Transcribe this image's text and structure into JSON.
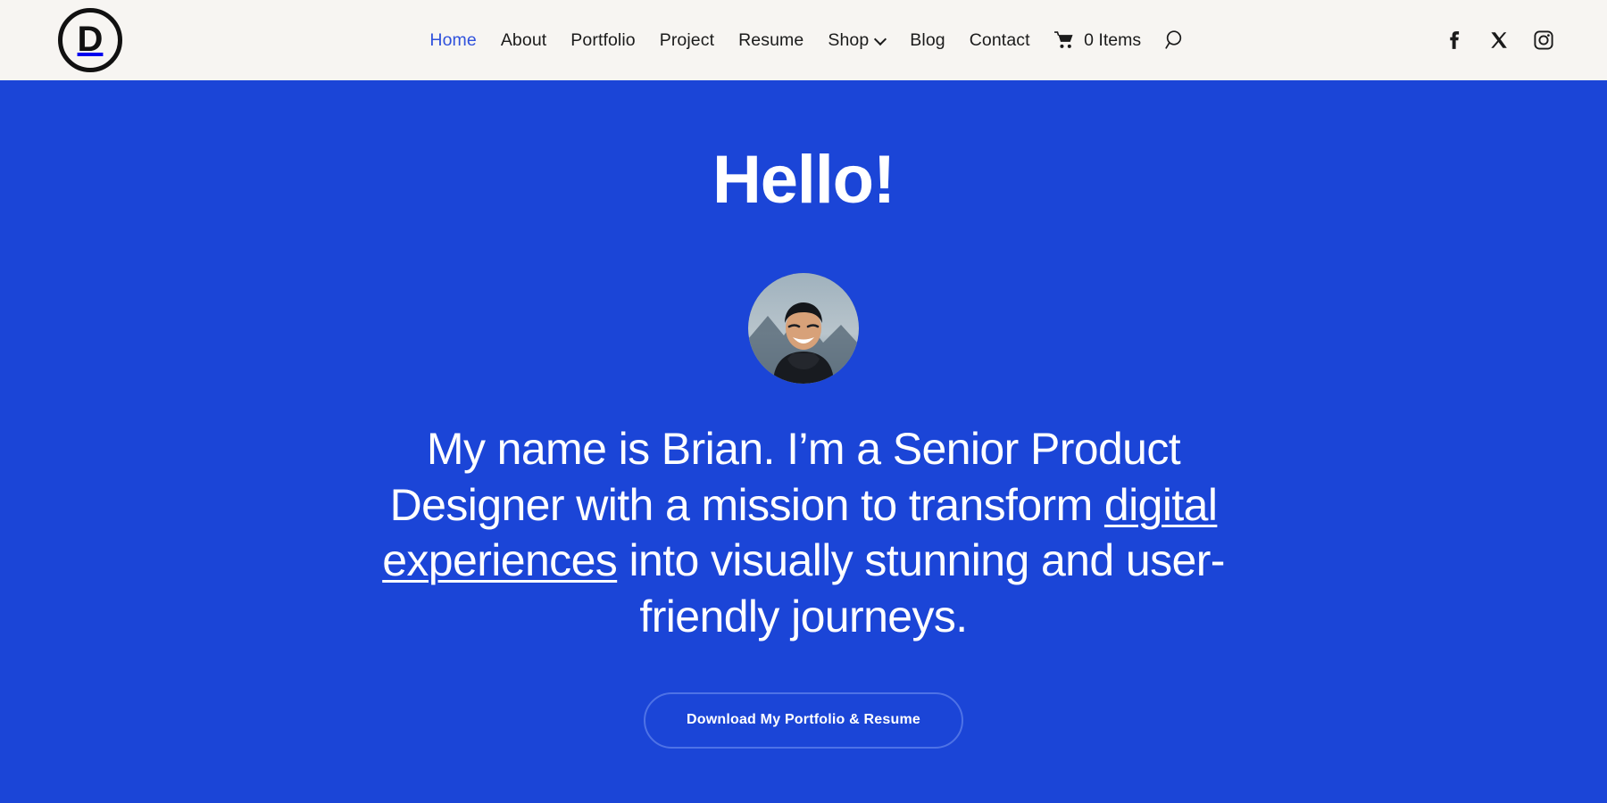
{
  "colors": {
    "header_bg": "#f7f5f2",
    "hero_bg": "#1b45d7",
    "nav_text": "#1b1b1b",
    "nav_active": "#2f51dc",
    "hero_text": "#ffffff",
    "button_border": "#4e72e6"
  },
  "header": {
    "logo": {
      "letter": "D",
      "icon": "circled-d-logo-icon"
    },
    "nav_items": [
      {
        "label": "Home",
        "active": true,
        "has_dropdown": false
      },
      {
        "label": "About",
        "active": false,
        "has_dropdown": false
      },
      {
        "label": "Portfolio",
        "active": false,
        "has_dropdown": false
      },
      {
        "label": "Project",
        "active": false,
        "has_dropdown": false
      },
      {
        "label": "Resume",
        "active": false,
        "has_dropdown": false
      },
      {
        "label": "Shop",
        "active": false,
        "has_dropdown": true
      },
      {
        "label": "Blog",
        "active": false,
        "has_dropdown": false
      },
      {
        "label": "Contact",
        "active": false,
        "has_dropdown": false
      }
    ],
    "cart": {
      "label": "0 Items",
      "icon": "shopping-cart-icon"
    },
    "search": {
      "icon": "search-icon"
    },
    "social": [
      {
        "name": "facebook-icon",
        "label": "f"
      },
      {
        "name": "x-twitter-icon",
        "label": "X"
      },
      {
        "name": "instagram-icon",
        "label": ""
      }
    ]
  },
  "hero": {
    "title": "Hello!",
    "avatar_alt": "portrait-photo",
    "lead_part1": "My name is Brian. I’m a Senior Product Designer with a mission to transform ",
    "lead_link": "digital experiences",
    "lead_part2": " into visually stunning and user-friendly journeys.",
    "cta_label": "Download My Portfolio & Resume"
  }
}
